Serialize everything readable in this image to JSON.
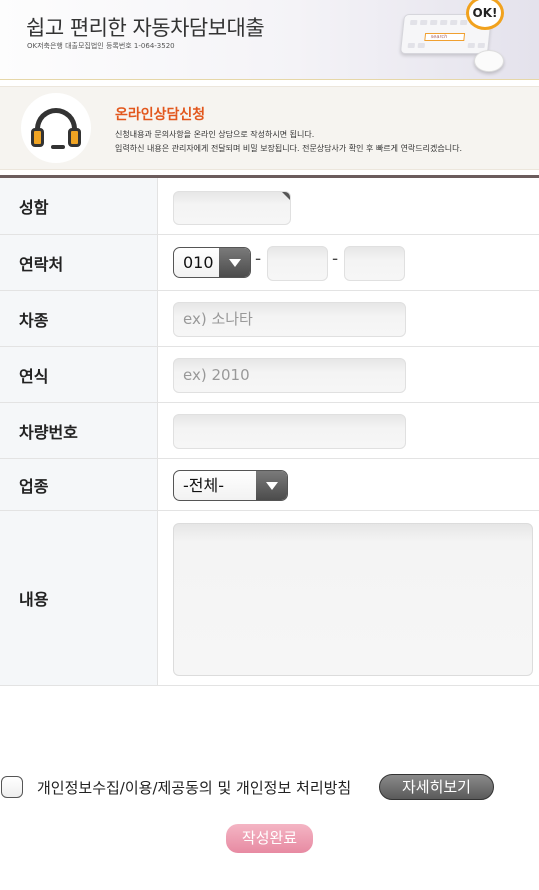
{
  "banner": {
    "title": "쉽고 편리한 자동차담보대출",
    "subtitle": "OK저축은행 대출모집법인 등록번호 1-064-3520",
    "badge": "OK!",
    "search_label": "search"
  },
  "consult": {
    "title": "온라인상담신청",
    "desc_line1": "신청내용과 문의사항을 온라인 상담으로 작성하시면 됩니다.",
    "desc_line2": "입력하신 내용은 관리자에게 전달되며 비밀 보장됩니다. 전문상담사가 확인 후 빠르게 연락드리겠습니다."
  },
  "form": {
    "name": {
      "label": "성함",
      "value": ""
    },
    "phone": {
      "label": "연락처",
      "prefix": "010",
      "separator": "-",
      "middle": "",
      "last": ""
    },
    "car_model": {
      "label": "차종",
      "placeholder": "ex) 소나타"
    },
    "car_year": {
      "label": "연식",
      "placeholder": "ex) 2010"
    },
    "car_number": {
      "label": "차량번호",
      "value": ""
    },
    "business": {
      "label": "업종",
      "selected": "-전체-"
    },
    "content": {
      "label": "내용",
      "value": ""
    }
  },
  "consent": {
    "text": "개인정보수집/이용/제공동의 및 개인정보 처리방침",
    "detail_button": "자세히보기",
    "checked": false
  },
  "submit": {
    "label": "작성완료"
  },
  "colors": {
    "accent_orange": "#e2571d",
    "divider": "#6b5c5c",
    "submit_pink": "#e78aa2",
    "header_bg": "#f5f7f9"
  }
}
